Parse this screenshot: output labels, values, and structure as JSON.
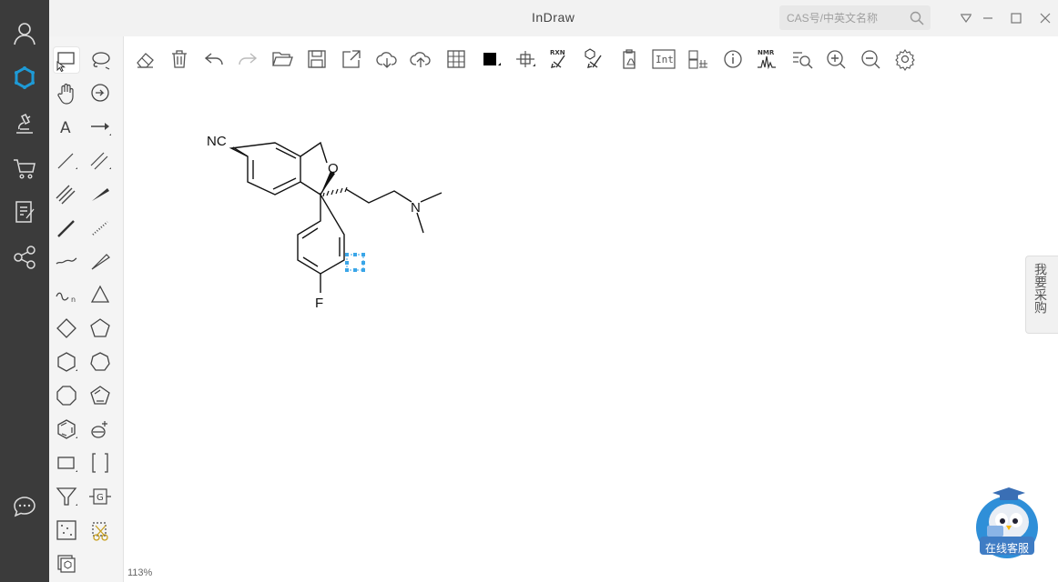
{
  "app": {
    "title": "InDraw"
  },
  "search": {
    "placeholder": "CAS号/中英文名称"
  },
  "canvas": {
    "zoom": "113%"
  },
  "molecule": {
    "atom_labels": {
      "nitrile": "NC",
      "oxygen": "O",
      "nitrogen": "N",
      "fluorine": "F"
    }
  },
  "side_panel": {
    "purchase": "我要采购"
  },
  "customer_service": {
    "label": "在线客服"
  },
  "toolbar": {
    "rxn": "RXN",
    "int": "Int",
    "nmr": "NMR"
  },
  "palette": {
    "text_tool": "A",
    "group_tool": "G"
  },
  "colors": {
    "sidebar": "#3b3b3b",
    "accent": "#1e9ad6",
    "selection": "#3aa6e8"
  }
}
